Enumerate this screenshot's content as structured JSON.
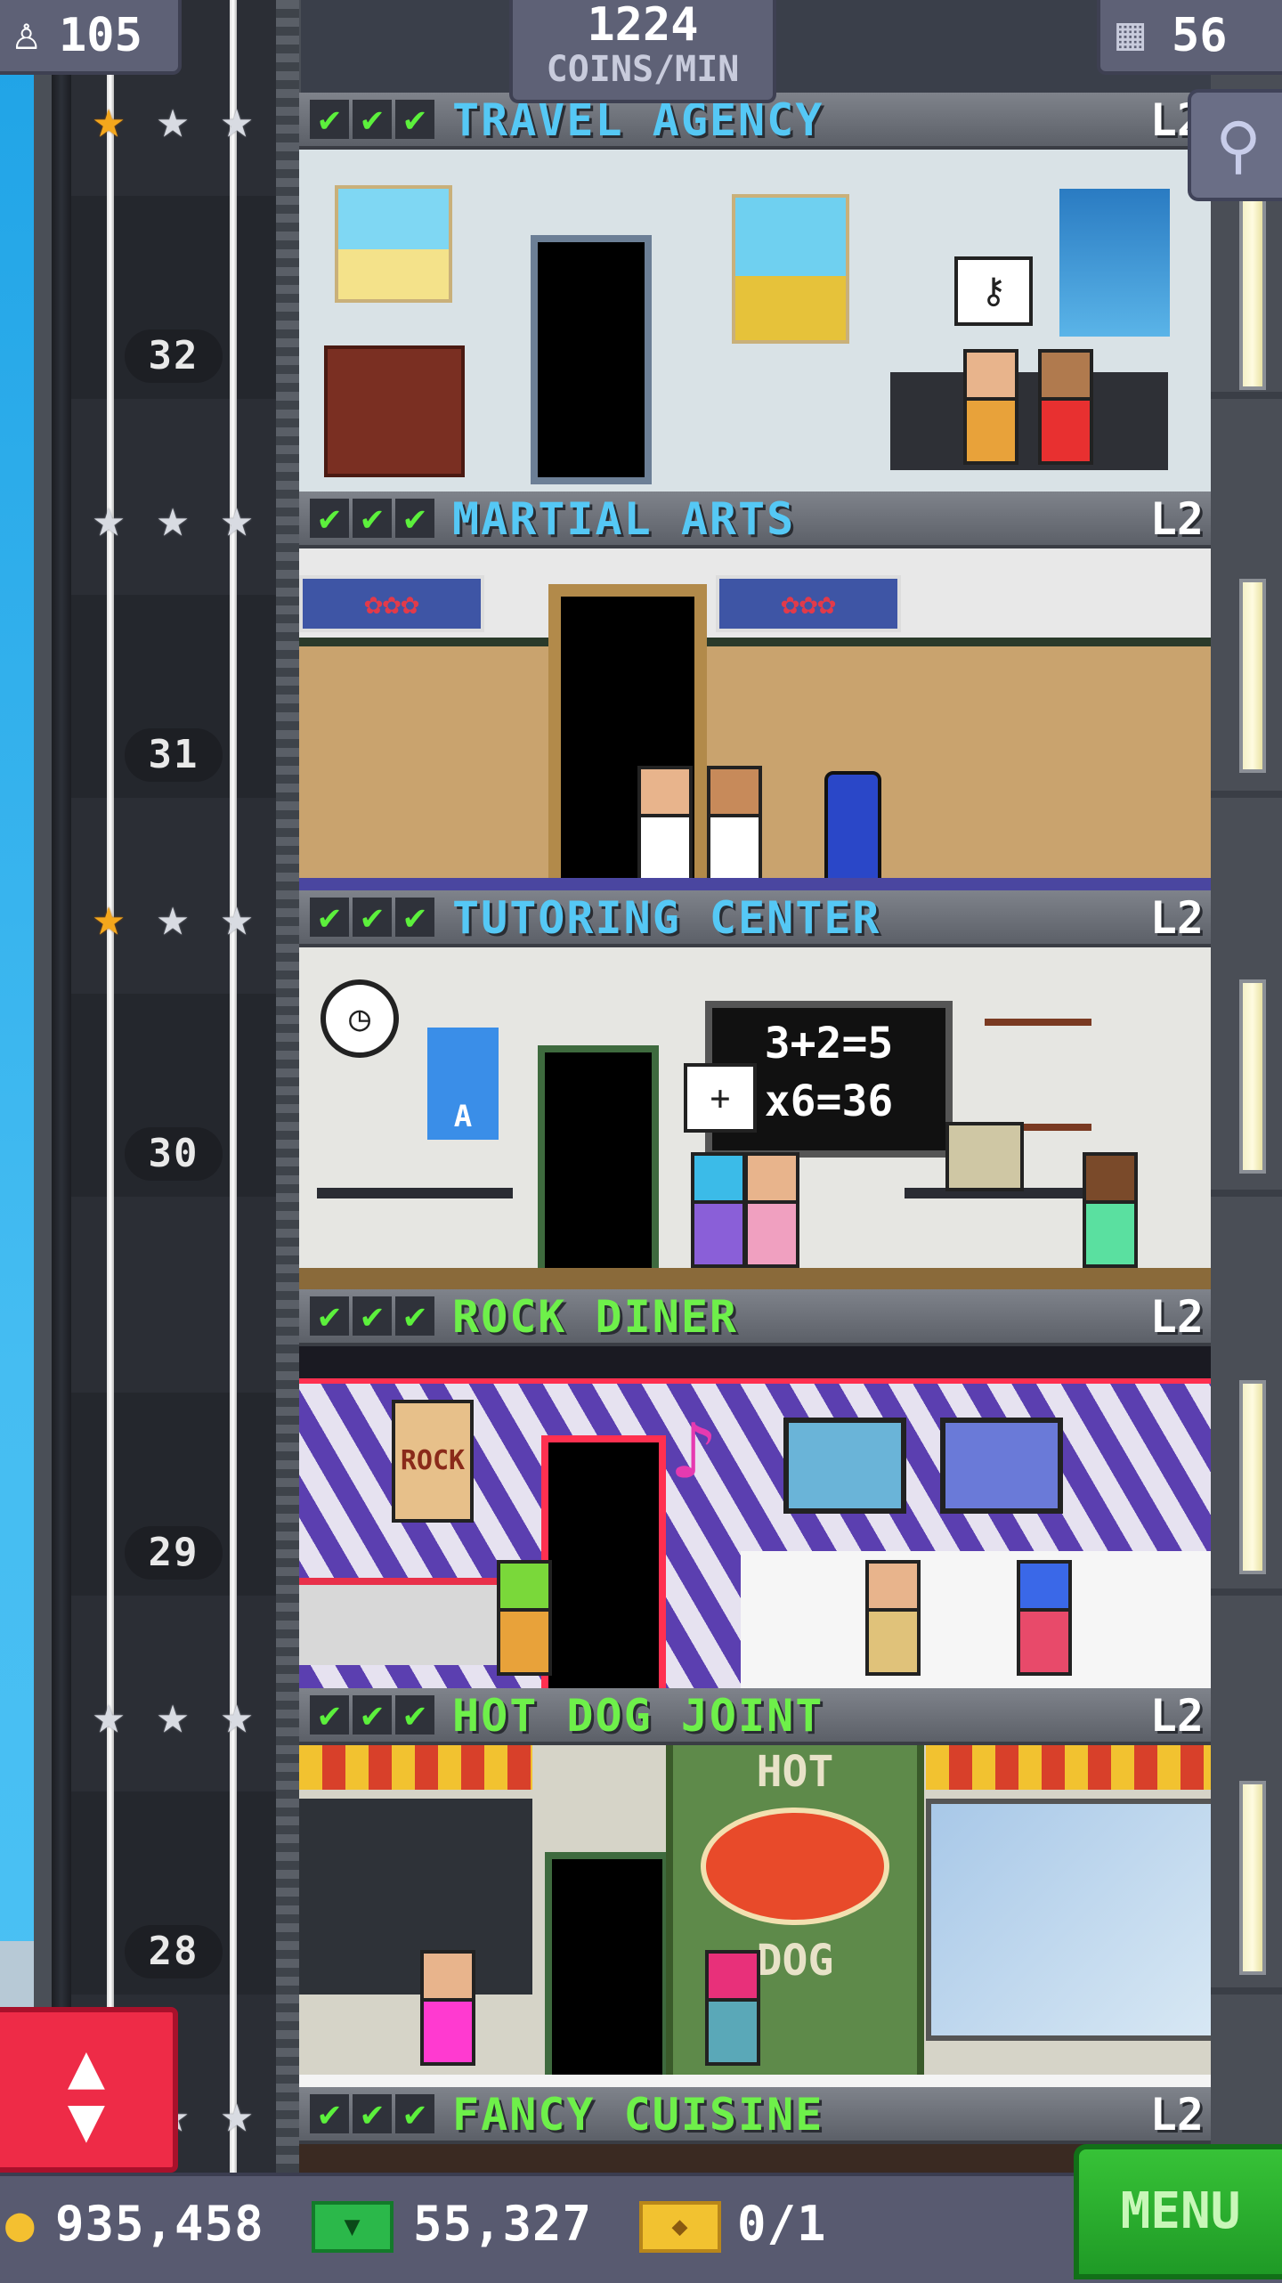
{
  "topbar": {
    "population": "105",
    "coins_per_min_value": "1224",
    "coins_per_min_label": "COINS/MIN",
    "floors_count": "56"
  },
  "floors": [
    {
      "number": "32",
      "name": "TRAVEL AGENCY",
      "level": "L2",
      "category": "service",
      "stars_gold": 1
    },
    {
      "number": "31",
      "name": "MARTIAL ARTS",
      "level": "L2",
      "category": "service",
      "stars_gold": 0
    },
    {
      "number": "30",
      "name": "TUTORING CENTER",
      "level": "L2",
      "category": "service",
      "stars_gold": 1
    },
    {
      "number": "29",
      "name": "ROCK DINER",
      "level": "L2",
      "category": "food",
      "stars_gold": 0
    },
    {
      "number": "28",
      "name": "HOT DOG JOINT",
      "level": "L2",
      "category": "food",
      "stars_gold": 0
    },
    {
      "number": "",
      "name": "FANCY CUISINE",
      "level": "L2",
      "category": "food",
      "stars_gold": 0
    }
  ],
  "decor": {
    "chalkboard_line1": "3+2=5",
    "chalkboard_line2": "x6=36",
    "poster_letter": "A",
    "hotdog_sign_top": "HOT",
    "hotdog_sign_bottom": "DOG",
    "rock_poster": "ROCK"
  },
  "bottombar": {
    "coins": "935,458",
    "bux": "55,327",
    "tickets": "0/1",
    "menu_label": "MENU"
  },
  "colors": {
    "service_name": "#55c8f5",
    "food_name": "#6ef04a",
    "check": "#5cf03c",
    "star_gold": "#f4a71c",
    "elevator_button": "#ee2b47",
    "menu_button": "#2aa82e"
  }
}
